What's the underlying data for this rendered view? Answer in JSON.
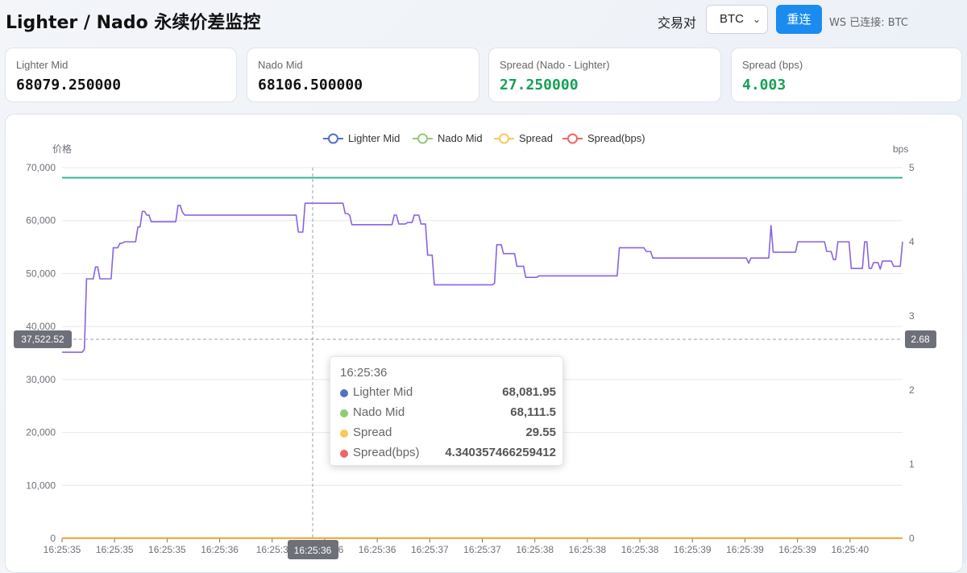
{
  "header": {
    "title": "Lighter / Nado 永续价差监控",
    "pair_label": "交易对",
    "pair_selected": "BTC",
    "reconnect_label": "重连",
    "ws_status": "WS 已连接: BTC"
  },
  "cards": [
    {
      "label": "Lighter Mid",
      "value": "68079.250000",
      "accent": false
    },
    {
      "label": "Nado Mid",
      "value": "68106.500000",
      "accent": false
    },
    {
      "label": "Spread (Nado - Lighter)",
      "value": "27.250000",
      "accent": true
    },
    {
      "label": "Spread (bps)",
      "value": "4.003",
      "accent": true
    }
  ],
  "colors": {
    "lighter": "#5470c6",
    "nado": "#91cc75",
    "spread": "#fac858",
    "bps": "#ee6666",
    "nado_line": "#2cb58a",
    "spread_line": "#f0a030",
    "bps_line": "#8a63e0",
    "accent_green": "#18a058",
    "button_blue": "#1a8cf0"
  },
  "tooltip": {
    "time": "16:25:36",
    "rows": [
      {
        "name": "Lighter Mid",
        "value": "68,081.95",
        "color": "#5470c6"
      },
      {
        "name": "Nado Mid",
        "value": "68,111.5",
        "color": "#91cc75"
      },
      {
        "name": "Spread",
        "value": "29.55",
        "color": "#fac858"
      },
      {
        "name": "Spread(bps)",
        "value": "4.340357466259412",
        "color": "#ee6666"
      }
    ]
  },
  "chart_data": {
    "type": "line",
    "legend": [
      "Lighter Mid",
      "Nado Mid",
      "Spread",
      "Spread(bps)"
    ],
    "legend_position": "top-center",
    "y_left_label": "价格",
    "y_right_label": "bps",
    "y_left_ticks": [
      "0",
      "10,000",
      "20,000",
      "30,000",
      "40,000",
      "50,000",
      "60,000",
      "70,000"
    ],
    "y_left_range": [
      0,
      70000
    ],
    "y_right_ticks": [
      "0",
      "1",
      "2",
      "3",
      "4",
      "5"
    ],
    "y_right_range": [
      0,
      5
    ],
    "x_ticks": [
      "16:25:35",
      "16:25:35",
      "16:25:35",
      "16:25:36",
      "16:25:3",
      "16:25:36",
      "16:25:36",
      "16:25:37",
      "16:25:37",
      "16:25:38",
      "16:25:38",
      "16:25:38",
      "16:25:39",
      "16:25:39",
      "16:25:39",
      "16:25:40"
    ],
    "crosshair": {
      "x_label": "16:25:36",
      "y_left_label": "37,522.52",
      "y_right_label": "2.68"
    },
    "grid": true,
    "series": [
      {
        "name": "Lighter Mid",
        "axis": "left",
        "values": [
          68079,
          68079
        ]
      },
      {
        "name": "Nado Mid",
        "axis": "left",
        "values": [
          68106,
          68106
        ]
      },
      {
        "name": "Spread",
        "axis": "left",
        "values": [
          27,
          27
        ]
      },
      {
        "name": "Spread(bps)",
        "axis": "right",
        "values": [
          2.51,
          2.51,
          2.51,
          2.51,
          2.51,
          2.51,
          2.51,
          2.51,
          2.51,
          2.51,
          2.55,
          3.5,
          3.5,
          3.5,
          3.5,
          3.66,
          3.66,
          3.5,
          3.5,
          3.5,
          3.5,
          3.5,
          3.5,
          3.92,
          3.92,
          3.92,
          3.98,
          3.98,
          4.0,
          4.0,
          4.0,
          4.0,
          4.0,
          4.0,
          4.2,
          4.2,
          4.41,
          4.41,
          4.36,
          4.36,
          4.27,
          4.27,
          4.27,
          4.27,
          4.27,
          4.27,
          4.27,
          4.27,
          4.27,
          4.27,
          4.27,
          4.27,
          4.49,
          4.49,
          4.4,
          4.36,
          4.36,
          4.36,
          4.36,
          4.36,
          4.36,
          4.36,
          4.36,
          4.36,
          4.36,
          4.36,
          4.36,
          4.36,
          4.36,
          4.36,
          4.36,
          4.36,
          4.36,
          4.36,
          4.36,
          4.36,
          4.36,
          4.36,
          4.36,
          4.36,
          4.36,
          4.36,
          4.36,
          4.36,
          4.36,
          4.36,
          4.36,
          4.36,
          4.36,
          4.36,
          4.36,
          4.36,
          4.36,
          4.36,
          4.36,
          4.36,
          4.36,
          4.36,
          4.36,
          4.36,
          4.36,
          4.36,
          4.36,
          4.36,
          4.36,
          4.36,
          4.13,
          4.13,
          4.13,
          4.52,
          4.52,
          4.52,
          4.52,
          4.52,
          4.52,
          4.52,
          4.52,
          4.52,
          4.52,
          4.52,
          4.52,
          4.52,
          4.52,
          4.52,
          4.52,
          4.52,
          4.52,
          4.38,
          4.38,
          4.36,
          4.23,
          4.23,
          4.23,
          4.23,
          4.23,
          4.23,
          4.23,
          4.23,
          4.23,
          4.23,
          4.23,
          4.23,
          4.23,
          4.23,
          4.23,
          4.23,
          4.23,
          4.23,
          4.23,
          4.36,
          4.36,
          4.24,
          4.24,
          4.24,
          4.24,
          4.26,
          4.26,
          4.26,
          4.36,
          4.36,
          4.36,
          4.24,
          4.24,
          4.24,
          3.82,
          3.82,
          3.82,
          3.42,
          3.42,
          3.42,
          3.42,
          3.42,
          3.42,
          3.42,
          3.42,
          3.42,
          3.42,
          3.42,
          3.42,
          3.42,
          3.42,
          3.42,
          3.42,
          3.42,
          3.42,
          3.42,
          3.42,
          3.42,
          3.42,
          3.42,
          3.42,
          3.42,
          3.42,
          3.42,
          3.44,
          3.96,
          3.96,
          3.96,
          3.84,
          3.84,
          3.84,
          3.84,
          3.84,
          3.84,
          3.67,
          3.67,
          3.67,
          3.67,
          3.52,
          3.52,
          3.52,
          3.52,
          3.52,
          3.52,
          3.54,
          3.54,
          3.54,
          3.54,
          3.54,
          3.54,
          3.54,
          3.54,
          3.54,
          3.54,
          3.54,
          3.54,
          3.54,
          3.54,
          3.54,
          3.54,
          3.54,
          3.54,
          3.54,
          3.54,
          3.54,
          3.54,
          3.54,
          3.54,
          3.54,
          3.54,
          3.54,
          3.54,
          3.54,
          3.54,
          3.54,
          3.54,
          3.54,
          3.54,
          3.54,
          3.54,
          3.92,
          3.92,
          3.92,
          3.92,
          3.92,
          3.92,
          3.92,
          3.92,
          3.92,
          3.92,
          3.92,
          3.92,
          3.87,
          3.87,
          3.87,
          3.78,
          3.78,
          3.78,
          3.78,
          3.78,
          3.78,
          3.78,
          3.78,
          3.78,
          3.78,
          3.78,
          3.78,
          3.78,
          3.78,
          3.78,
          3.78,
          3.78,
          3.78,
          3.78,
          3.78,
          3.78,
          3.78,
          3.78,
          3.78,
          3.78,
          3.78,
          3.78,
          3.78,
          3.78,
          3.78,
          3.78,
          3.78,
          3.78,
          3.78,
          3.78,
          3.78,
          3.78,
          3.78,
          3.78,
          3.78,
          3.78,
          3.78,
          3.78,
          3.71,
          3.78,
          3.78,
          3.78,
          3.78,
          3.78,
          3.78,
          3.78,
          3.78,
          3.78,
          4.22,
          3.86,
          3.86,
          3.86,
          3.86,
          3.86,
          3.86,
          3.86,
          3.86,
          3.86,
          3.86,
          3.86,
          4.0,
          4.0,
          4.0,
          4.0,
          4.0,
          4.0,
          4.0,
          4.0,
          4.0,
          4.0,
          4.0,
          4.0,
          4.0,
          3.87,
          3.87,
          3.87,
          3.76,
          3.76,
          4.0,
          4.0,
          4.0,
          4.0,
          4.0,
          4.0,
          3.64,
          3.64,
          3.64,
          3.64,
          3.64,
          3.64,
          4.0,
          4.0,
          3.64,
          3.64,
          3.72,
          3.72,
          3.72,
          3.63,
          3.74,
          3.74,
          3.74,
          3.74,
          3.74,
          3.67,
          3.67,
          3.67,
          3.67,
          4.0
        ]
      }
    ]
  }
}
